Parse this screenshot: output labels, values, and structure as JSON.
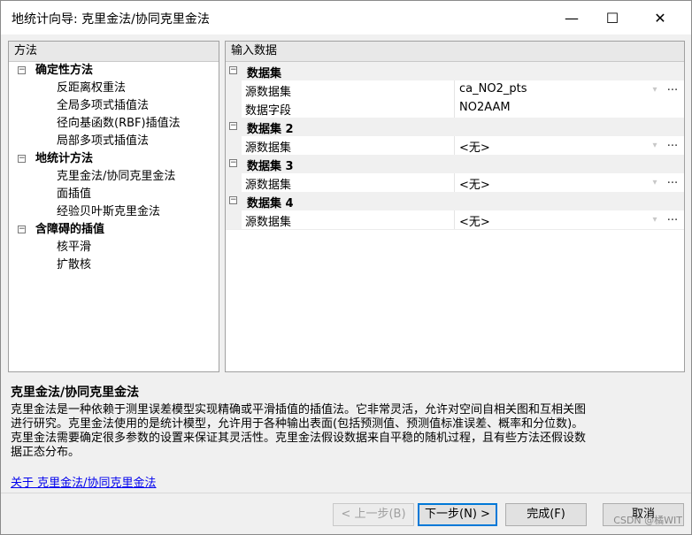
{
  "window": {
    "title": "地统计向导: 克里金法/协同克里金法",
    "controls": {
      "minimize": "—",
      "maximize": "☐",
      "close": "✕"
    }
  },
  "left_panel": {
    "header": "方法",
    "groups": [
      {
        "label": "确定性方法",
        "toggle": "−",
        "items": [
          "反距离权重法",
          "全局多项式插值法",
          "径向基函数(RBF)插值法",
          "局部多项式插值法"
        ]
      },
      {
        "label": "地统计方法",
        "toggle": "−",
        "items": [
          "克里金法/协同克里金法",
          "面插值",
          "经验贝叶斯克里金法"
        ]
      },
      {
        "label": "含障碍的插值",
        "toggle": "−",
        "items": [
          "核平滑",
          "扩散核"
        ]
      }
    ]
  },
  "right_panel": {
    "header": "输入数据",
    "categories": [
      {
        "label": "数据集",
        "toggle": "−",
        "props": [
          {
            "name": "源数据集",
            "value": "ca_NO2_pts",
            "dropdown": "▾",
            "button": "..."
          },
          {
            "name": "数据字段",
            "value": "NO2AAM",
            "dropdown": "",
            "button": ""
          }
        ]
      },
      {
        "label": "数据集 2",
        "toggle": "−",
        "props": [
          {
            "name": "源数据集",
            "value": "<无>",
            "dropdown": "▾",
            "button": "..."
          }
        ]
      },
      {
        "label": "数据集 3",
        "toggle": "−",
        "props": [
          {
            "name": "源数据集",
            "value": "<无>",
            "dropdown": "▾",
            "button": "..."
          }
        ]
      },
      {
        "label": "数据集 4",
        "toggle": "−",
        "props": [
          {
            "name": "源数据集",
            "value": "<无>",
            "dropdown": "▾",
            "button": "..."
          }
        ]
      }
    ]
  },
  "description": {
    "title": "克里金法/协同克里金法",
    "lines": [
      "克里金法是一种依赖于测里误差模型实现精确或平滑插值的插值法。它非常灵活，允许对空间自相关图和互相关图",
      "进行研究。克里金法使用的是统计模型，允许用于各种输出表面(包括预测值、预测值标准误差、概率和分位数)。",
      "克里金法需要确定很多参数的设置来保证其灵活性。克里金法假设数据来自平稳的随机过程，且有些方法还假设数",
      "据正态分布。"
    ],
    "link": "关于 克里金法/协同克里金法"
  },
  "buttons": {
    "back": "< 上一步(B)",
    "next": "下一步(N) >",
    "finish": "完成(F)",
    "cancel": "取消"
  },
  "watermark": "CSDN @橘WIT"
}
